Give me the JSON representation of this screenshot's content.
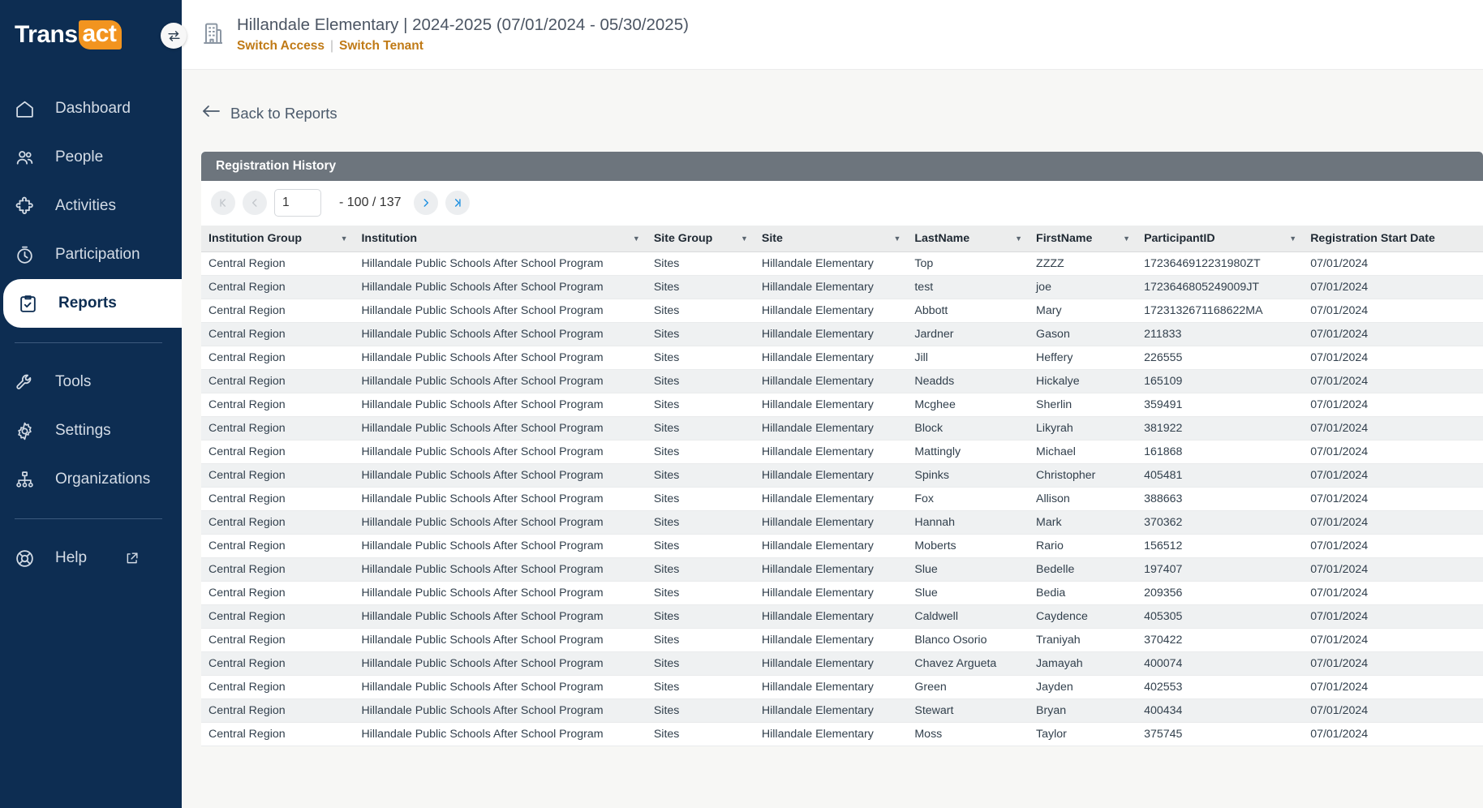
{
  "brand": {
    "logo_prefix": "Trans",
    "logo_suffix": "act",
    "accent_orange": "#f2941f",
    "sidebar_navy": "#0d2d52",
    "link_orange": "#c07a16",
    "panel_gray": "#6d757d",
    "pager_blue": "#1d8fe0"
  },
  "sidebar": {
    "switch_button_label": "switch-sidebar",
    "items": [
      {
        "label": "Dashboard",
        "icon": "home-icon",
        "active": false
      },
      {
        "label": "People",
        "icon": "people-icon",
        "active": false
      },
      {
        "label": "Activities",
        "icon": "puzzle-icon",
        "active": false
      },
      {
        "label": "Participation",
        "icon": "stopwatch-icon",
        "active": false
      },
      {
        "label": "Reports",
        "icon": "clipboard-check-icon",
        "active": true
      }
    ],
    "items_secondary": [
      {
        "label": "Tools",
        "icon": "wrench-icon"
      },
      {
        "label": "Settings",
        "icon": "gear-icon"
      },
      {
        "label": "Organizations",
        "icon": "org-chart-icon"
      }
    ],
    "help": {
      "label": "Help",
      "icon": "lifebuoy-icon",
      "external_icon": "external-link-icon"
    }
  },
  "topbar": {
    "icon": "building-icon",
    "tenant_line": "Hillandale Elementary | 2024-2025 (07/01/2024 - 05/30/2025)",
    "switch_access": "Switch Access",
    "separator": "|",
    "switch_tenant": "Switch Tenant"
  },
  "back_link": {
    "icon": "arrow-left-icon",
    "label": "Back to Reports"
  },
  "panel": {
    "title": "Registration History",
    "pager": {
      "first_icon": "first-page-icon",
      "prev_icon": "prev-page-icon",
      "page_value": "1",
      "page_placeholder": "",
      "range_text": "- 100 / 137",
      "next_icon": "next-page-icon",
      "last_icon": "last-page-icon"
    },
    "columns": [
      {
        "label": "Institution Group",
        "caret": true
      },
      {
        "label": "Institution",
        "caret": true
      },
      {
        "label": "Site Group",
        "caret": true
      },
      {
        "label": "Site",
        "caret": true
      },
      {
        "label": "LastName",
        "caret": true
      },
      {
        "label": "FirstName",
        "caret": true
      },
      {
        "label": "ParticipantID",
        "caret": true
      },
      {
        "label": "Registration Start Date",
        "caret": false
      }
    ],
    "rows": [
      [
        "Central Region",
        "Hillandale Public Schools After School Program",
        "Sites",
        "Hillandale Elementary",
        "Top",
        "ZZZZ",
        "1723646912231980ZT",
        "07/01/2024"
      ],
      [
        "Central Region",
        "Hillandale Public Schools After School Program",
        "Sites",
        "Hillandale Elementary",
        "test",
        "joe",
        "1723646805249009JT",
        "07/01/2024"
      ],
      [
        "Central Region",
        "Hillandale Public Schools After School Program",
        "Sites",
        "Hillandale Elementary",
        "Abbott",
        "Mary",
        "1723132671168622MA",
        "07/01/2024"
      ],
      [
        "Central Region",
        "Hillandale Public Schools After School Program",
        "Sites",
        "Hillandale Elementary",
        "Jardner",
        "Gason",
        "211833",
        "07/01/2024"
      ],
      [
        "Central Region",
        "Hillandale Public Schools After School Program",
        "Sites",
        "Hillandale Elementary",
        "Jill",
        "Heffery",
        "226555",
        "07/01/2024"
      ],
      [
        "Central Region",
        "Hillandale Public Schools After School Program",
        "Sites",
        "Hillandale Elementary",
        "Neadds",
        "Hickalye",
        "165109",
        "07/01/2024"
      ],
      [
        "Central Region",
        "Hillandale Public Schools After School Program",
        "Sites",
        "Hillandale Elementary",
        "Mcghee",
        "Sherlin",
        "359491",
        "07/01/2024"
      ],
      [
        "Central Region",
        "Hillandale Public Schools After School Program",
        "Sites",
        "Hillandale Elementary",
        "Block",
        "Likyrah",
        "381922",
        "07/01/2024"
      ],
      [
        "Central Region",
        "Hillandale Public Schools After School Program",
        "Sites",
        "Hillandale Elementary",
        "Mattingly",
        "Michael",
        "161868",
        "07/01/2024"
      ],
      [
        "Central Region",
        "Hillandale Public Schools After School Program",
        "Sites",
        "Hillandale Elementary",
        "Spinks",
        "Christopher",
        "405481",
        "07/01/2024"
      ],
      [
        "Central Region",
        "Hillandale Public Schools After School Program",
        "Sites",
        "Hillandale Elementary",
        "Fox",
        "Allison",
        "388663",
        "07/01/2024"
      ],
      [
        "Central Region",
        "Hillandale Public Schools After School Program",
        "Sites",
        "Hillandale Elementary",
        "Hannah",
        "Mark",
        "370362",
        "07/01/2024"
      ],
      [
        "Central Region",
        "Hillandale Public Schools After School Program",
        "Sites",
        "Hillandale Elementary",
        "Moberts",
        "Rario",
        "156512",
        "07/01/2024"
      ],
      [
        "Central Region",
        "Hillandale Public Schools After School Program",
        "Sites",
        "Hillandale Elementary",
        "Slue",
        "Bedelle",
        "197407",
        "07/01/2024"
      ],
      [
        "Central Region",
        "Hillandale Public Schools After School Program",
        "Sites",
        "Hillandale Elementary",
        "Slue",
        "Bedia",
        "209356",
        "07/01/2024"
      ],
      [
        "Central Region",
        "Hillandale Public Schools After School Program",
        "Sites",
        "Hillandale Elementary",
        "Caldwell",
        "Caydence",
        "405305",
        "07/01/2024"
      ],
      [
        "Central Region",
        "Hillandale Public Schools After School Program",
        "Sites",
        "Hillandale Elementary",
        "Blanco Osorio",
        "Traniyah",
        "370422",
        "07/01/2024"
      ],
      [
        "Central Region",
        "Hillandale Public Schools After School Program",
        "Sites",
        "Hillandale Elementary",
        "Chavez Argueta",
        "Jamayah",
        "400074",
        "07/01/2024"
      ],
      [
        "Central Region",
        "Hillandale Public Schools After School Program",
        "Sites",
        "Hillandale Elementary",
        "Green",
        "Jayden",
        "402553",
        "07/01/2024"
      ],
      [
        "Central Region",
        "Hillandale Public Schools After School Program",
        "Sites",
        "Hillandale Elementary",
        "Stewart",
        "Bryan",
        "400434",
        "07/01/2024"
      ],
      [
        "Central Region",
        "Hillandale Public Schools After School Program",
        "Sites",
        "Hillandale Elementary",
        "Moss",
        "Taylor",
        "375745",
        "07/01/2024"
      ]
    ]
  }
}
